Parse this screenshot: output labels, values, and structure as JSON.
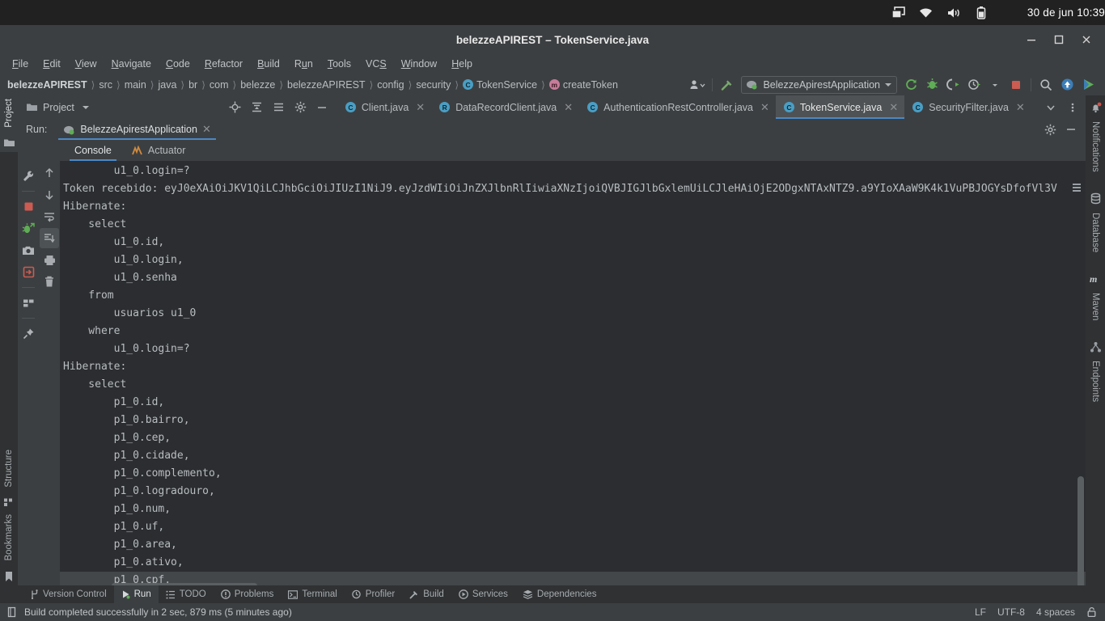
{
  "os_bar": {
    "tray_icons": [
      "window-switcher-icon",
      "wifi-icon",
      "volume-icon",
      "battery-icon"
    ],
    "clock": "30 de jun  10:39"
  },
  "window": {
    "title": "belezzeAPIREST – TokenService.java",
    "buttons": [
      "minimize-button",
      "maximize-button",
      "close-button"
    ]
  },
  "menu": {
    "items": [
      {
        "pre": "",
        "mn": "F",
        "post": "ile"
      },
      {
        "pre": "",
        "mn": "E",
        "post": "dit"
      },
      {
        "pre": "",
        "mn": "V",
        "post": "iew"
      },
      {
        "pre": "",
        "mn": "N",
        "post": "avigate"
      },
      {
        "pre": "",
        "mn": "C",
        "post": "ode"
      },
      {
        "pre": "",
        "mn": "R",
        "post": "efactor"
      },
      {
        "pre": "",
        "mn": "B",
        "post": "uild"
      },
      {
        "pre": "R",
        "mn": "u",
        "post": "n"
      },
      {
        "pre": "",
        "mn": "T",
        "post": "ools"
      },
      {
        "pre": "VC",
        "mn": "S",
        "post": ""
      },
      {
        "pre": "",
        "mn": "W",
        "post": "indow"
      },
      {
        "pre": "",
        "mn": "H",
        "post": "elp"
      }
    ]
  },
  "breadcrumb": {
    "items": [
      {
        "label": "belezzeAPIREST",
        "icon": null
      },
      {
        "label": "src",
        "icon": null
      },
      {
        "label": "main",
        "icon": null
      },
      {
        "label": "java",
        "icon": null
      },
      {
        "label": "br",
        "icon": null
      },
      {
        "label": "com",
        "icon": null
      },
      {
        "label": "belezze",
        "icon": null
      },
      {
        "label": "belezzeAPIREST",
        "icon": null
      },
      {
        "label": "config",
        "icon": null
      },
      {
        "label": "security",
        "icon": null
      },
      {
        "label": "TokenService",
        "icon": "class-icon",
        "badge": "C"
      },
      {
        "label": "createToken",
        "icon": "method-icon",
        "badge": "m"
      }
    ]
  },
  "toolbar": {
    "profile_icon": "user-dropdown-icon",
    "build_icon": "hammer-icon",
    "run_config_name": "BelezzeApirestApplication",
    "run_config_icon": "spring-boot-icon",
    "icons": [
      "rerun-icon",
      "debug-icon",
      "coverage-icon",
      "profiler-icon",
      "stop-icon",
      "search-icon",
      "update-project-icon",
      "run-icon"
    ]
  },
  "project_tool": {
    "label": "Project",
    "icons": [
      "locate-icon",
      "expand-all-icon",
      "collapse-all-icon",
      "settings-icon",
      "hide-icon"
    ]
  },
  "editor_tabs": [
    {
      "label": "Client.java",
      "badge": "C",
      "kind": "class",
      "active": false
    },
    {
      "label": "DataRecordClient.java",
      "badge": "R",
      "kind": "record",
      "active": false
    },
    {
      "label": "AuthenticationRestController.java",
      "badge": "C",
      "kind": "class",
      "active": false
    },
    {
      "label": "TokenService.java",
      "badge": "C",
      "kind": "class",
      "active": true
    },
    {
      "label": "SecurityFilter.java",
      "badge": "C",
      "kind": "class",
      "active": false
    }
  ],
  "tab_extras": [
    "tab-list-chevron-icon",
    "tab-options-icon"
  ],
  "left_stripe": {
    "top": [
      {
        "label": "Project",
        "icon": "project-folder-icon",
        "selected": true
      }
    ],
    "bottom": [
      {
        "label": "Structure",
        "icon": "structure-icon"
      },
      {
        "label": "Bookmarks",
        "icon": "bookmark-icon"
      }
    ]
  },
  "right_stripe": [
    {
      "label": "Notifications",
      "icon": "notifications-bell-icon"
    },
    {
      "label": "Database",
      "icon": "database-icon"
    },
    {
      "label": "Maven",
      "icon": "maven-icon"
    },
    {
      "label": "Endpoints",
      "icon": "endpoints-icon"
    }
  ],
  "run_window": {
    "run_label": "Run:",
    "session_name": "BelezzeApirestApplication",
    "header_icons": [
      "settings-icon",
      "hide-icon"
    ],
    "left_tools": [
      "wrench-icon",
      "stop-icon",
      "rerun-debug-icon",
      "camera-icon",
      "export-icon",
      "layout-icon",
      "pin-icon"
    ],
    "gutter_tools": [
      "scroll-up-icon",
      "scroll-down-icon",
      "soft-wrap-icon",
      "scroll-to-end-icon",
      "print-icon",
      "trash-icon"
    ],
    "tabs": [
      {
        "label": "Console",
        "icon": "console-icon",
        "active": true
      },
      {
        "label": "Actuator",
        "icon": "actuator-icon",
        "active": false
      }
    ],
    "console_lines": [
      {
        "text": "        u1_0.login=?",
        "highlight": false
      },
      {
        "text": "Token recebido: eyJ0eXAiOiJKV1QiLCJhbGciOiJIUzI1NiJ9.eyJzdWIiOiJnZXJlbnRlIiwiaXNzIjoiQVBJIGJlbGxlemUiLCJleHAiOjE2ODgxNTAxNTZ9.a9YIoXAaW9K4k1VuPBJOGYsDfofVl3V",
        "highlight": false
      },
      {
        "text": "Hibernate: ",
        "highlight": false
      },
      {
        "text": "    select",
        "highlight": false
      },
      {
        "text": "        u1_0.id,",
        "highlight": false
      },
      {
        "text": "        u1_0.login,",
        "highlight": false
      },
      {
        "text": "        u1_0.senha",
        "highlight": false
      },
      {
        "text": "    from",
        "highlight": false
      },
      {
        "text": "        usuarios u1_0",
        "highlight": false
      },
      {
        "text": "    where",
        "highlight": false
      },
      {
        "text": "        u1_0.login=?",
        "highlight": false
      },
      {
        "text": "Hibernate: ",
        "highlight": false
      },
      {
        "text": "    select",
        "highlight": false
      },
      {
        "text": "        p1_0.id,",
        "highlight": false
      },
      {
        "text": "        p1_0.bairro,",
        "highlight": false
      },
      {
        "text": "        p1_0.cep,",
        "highlight": false
      },
      {
        "text": "        p1_0.cidade,",
        "highlight": false
      },
      {
        "text": "        p1_0.complemento,",
        "highlight": false
      },
      {
        "text": "        p1_0.logradouro,",
        "highlight": false
      },
      {
        "text": "        p1_0.num,",
        "highlight": false
      },
      {
        "text": "        p1_0.uf,",
        "highlight": false
      },
      {
        "text": "        p1_0.area,",
        "highlight": false
      },
      {
        "text": "        p1_0.ativo,",
        "highlight": false
      },
      {
        "text": "        p1_0.cpf,",
        "highlight": true
      }
    ]
  },
  "bottom_stripe": [
    {
      "label": "Version Control",
      "icon": "branch-icon",
      "selected": false
    },
    {
      "label": "Run",
      "icon": "run-play-icon",
      "selected": true
    },
    {
      "label": "TODO",
      "icon": "todo-list-icon",
      "selected": false
    },
    {
      "label": "Problems",
      "icon": "problems-icon",
      "selected": false
    },
    {
      "label": "Terminal",
      "icon": "terminal-icon",
      "selected": false
    },
    {
      "label": "Profiler",
      "icon": "profiler-icon",
      "selected": false
    },
    {
      "label": "Build",
      "icon": "hammer-icon",
      "selected": false
    },
    {
      "label": "Services",
      "icon": "services-icon",
      "selected": false
    },
    {
      "label": "Dependencies",
      "icon": "dependencies-icon",
      "selected": false
    }
  ],
  "status_bar": {
    "icon": "build-status-icon",
    "message": "Build completed successfully in 2 sec, 879 ms (5 minutes ago)",
    "line_separator": "LF",
    "encoding": "UTF-8",
    "indent": "4 spaces",
    "lock_icon": "read-only-lock-icon"
  },
  "colors": {
    "accent_blue": "#4a88c7",
    "panel": "#3c3f41",
    "console_bg": "#2b2d30",
    "stripe": "#2f3133",
    "text": "#b9bdc1"
  }
}
